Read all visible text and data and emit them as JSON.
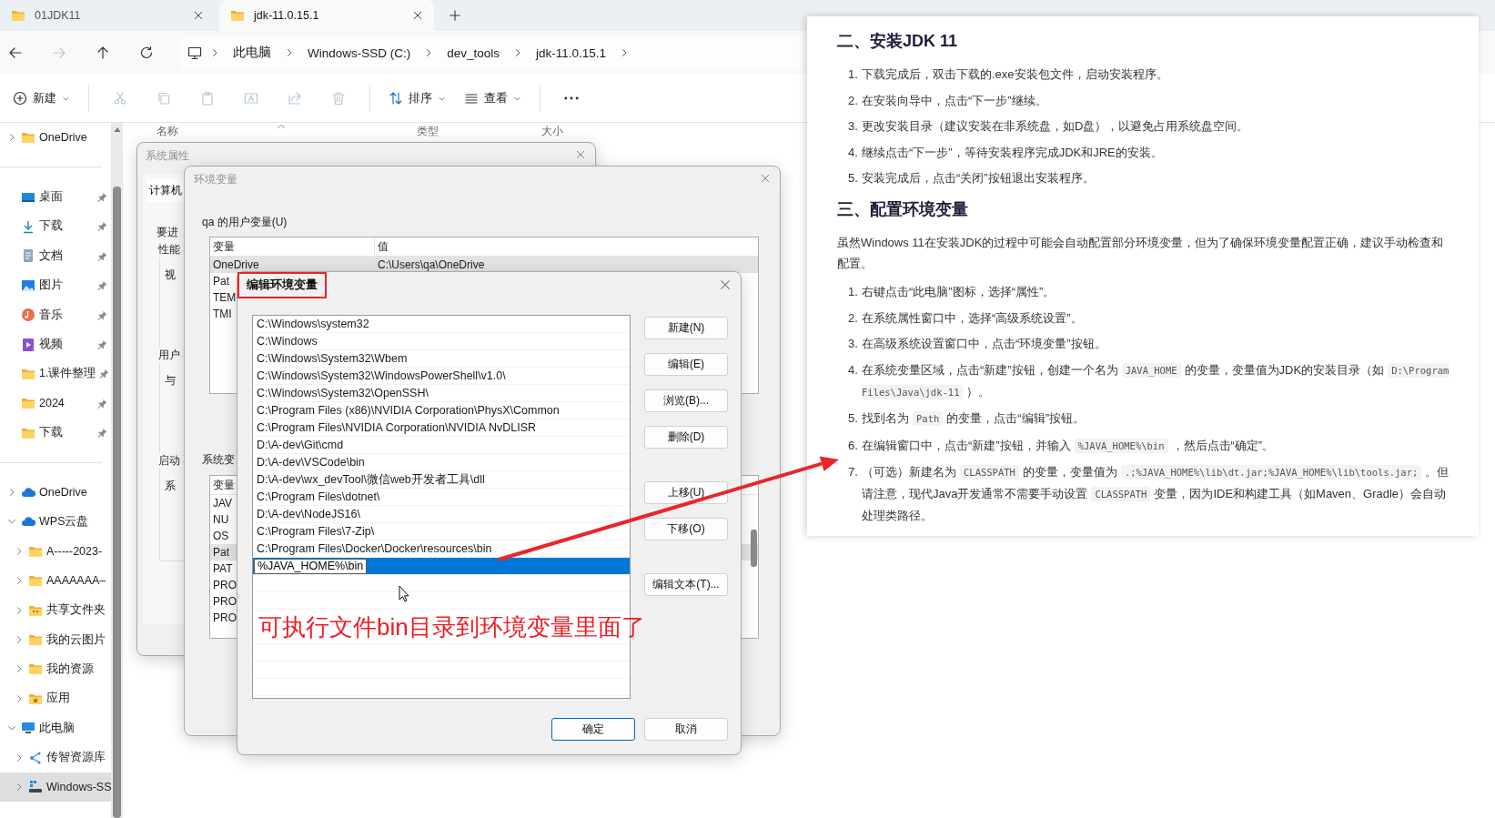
{
  "explorer": {
    "tabs": [
      {
        "label": "01JDK11",
        "selected": false
      },
      {
        "label": "jdk-11.0.15.1",
        "selected": true
      }
    ],
    "nav_buttons": [
      {
        "kind": "back",
        "disabled": false
      },
      {
        "kind": "forward",
        "disabled": true
      },
      {
        "kind": "up",
        "disabled": false
      },
      {
        "kind": "refresh",
        "disabled": false
      }
    ],
    "breadcrumb": [
      "此电脑",
      "Windows-SSD (C:)",
      "dev_tools",
      "jdk-11.0.15.1"
    ],
    "toolbar": [
      [
        {
          "kind": "new",
          "label": "新建",
          "dropdown": true,
          "disabled": false
        }
      ],
      [
        {
          "kind": "cut",
          "disabled": true
        },
        {
          "kind": "copy",
          "disabled": true
        },
        {
          "kind": "paste",
          "disabled": true
        },
        {
          "kind": "rename",
          "disabled": true
        },
        {
          "kind": "share",
          "disabled": true
        },
        {
          "kind": "delete",
          "disabled": true
        }
      ],
      [
        {
          "kind": "sort",
          "label": "排序",
          "dropdown": true,
          "disabled": false
        },
        {
          "kind": "view",
          "label": "查看",
          "dropdown": true,
          "disabled": false
        }
      ],
      [
        {
          "kind": "more",
          "disabled": false
        }
      ]
    ],
    "sidebar": [
      [
        {
          "label": "OneDrive",
          "kind": "folder",
          "expandable": true,
          "expanded": false,
          "pinned": false,
          "selected": false
        }
      ],
      [
        {
          "label": "桌面",
          "kind": "desktop",
          "expandable": false,
          "pinned": true,
          "selected": false
        },
        {
          "label": "下载",
          "kind": "download",
          "expandable": false,
          "pinned": true,
          "selected": false
        },
        {
          "label": "文档",
          "kind": "document",
          "expandable": false,
          "pinned": true,
          "selected": false
        },
        {
          "label": "图片",
          "kind": "picture",
          "expandable": false,
          "pinned": true,
          "selected": false
        },
        {
          "label": "音乐",
          "kind": "music",
          "expandable": false,
          "pinned": true,
          "selected": false
        },
        {
          "label": "视频",
          "kind": "video",
          "expandable": false,
          "pinned": true,
          "selected": false
        },
        {
          "label": "1.课件整理",
          "kind": "folder",
          "expandable": false,
          "pinned": true,
          "selected": false
        },
        {
          "label": "2024",
          "kind": "folder",
          "expandable": false,
          "pinned": true,
          "selected": false
        },
        {
          "label": "下载",
          "kind": "folder",
          "expandable": false,
          "pinned": true,
          "selected": false
        }
      ],
      [
        {
          "label": "OneDrive",
          "kind": "cloud",
          "expandable": true,
          "expanded": false,
          "pinned": false,
          "selected": false
        },
        {
          "label": "WPS云盘",
          "kind": "cloud",
          "expandable": true,
          "expanded": true,
          "pinned": false,
          "selected": false,
          "children": [
            {
              "label": "A-----2023-",
              "kind": "folder",
              "expandable": true,
              "expanded": false,
              "pinned": false,
              "selected": false
            },
            {
              "label": "AAAAAAA–",
              "kind": "folder",
              "expandable": true,
              "expanded": false,
              "pinned": false,
              "selected": false
            },
            {
              "label": "共享文件夹",
              "kind": "shared-folder",
              "expandable": true,
              "expanded": false,
              "pinned": false,
              "selected": false
            },
            {
              "label": "我的云图片",
              "kind": "folder",
              "expandable": true,
              "expanded": false,
              "pinned": false,
              "selected": false
            },
            {
              "label": "我的资源",
              "kind": "folder",
              "expandable": true,
              "expanded": false,
              "pinned": false,
              "selected": false
            },
            {
              "label": "应用",
              "kind": "app-folder",
              "expandable": true,
              "expanded": false,
              "pinned": false,
              "selected": false
            }
          ]
        },
        {
          "label": "此电脑",
          "kind": "computer",
          "expandable": true,
          "expanded": true,
          "pinned": false,
          "selected": false,
          "children": [
            {
              "label": "传智资源库",
              "kind": "network",
              "expandable": true,
              "expanded": false,
              "pinned": false,
              "selected": false
            },
            {
              "label": "Windows-SS",
              "kind": "drive",
              "expandable": true,
              "expanded": false,
              "pinned": false,
              "selected": true
            }
          ]
        }
      ]
    ],
    "columns": [
      "名称",
      "类型",
      "大小"
    ]
  },
  "system_properties": {
    "title": "系统属性",
    "tab": "计算机",
    "intro": "要进",
    "groups": [
      {
        "title": "性能",
        "text": "视"
      },
      {
        "title": "用户",
        "text": "与"
      },
      {
        "title": "启动",
        "text": "系"
      }
    ]
  },
  "environment_variables": {
    "title": "环境变量",
    "user_label": "qa 的用户变量(U)",
    "user_columns": [
      "变量",
      "值"
    ],
    "user_rows": [
      {
        "name": "OneDrive",
        "value": "C:\\Users\\qa\\OneDrive",
        "selected": true
      },
      {
        "name": "Pat",
        "selected": false
      },
      {
        "name": "TEM",
        "selected": false
      },
      {
        "name": "TMI",
        "selected": false
      }
    ],
    "system_label": "系统变",
    "system_columns": [
      "变量"
    ],
    "system_rows": [
      {
        "name": "JAV",
        "selected": false
      },
      {
        "name": "NU",
        "selected": false
      },
      {
        "name": "OS",
        "selected": false
      },
      {
        "name": "Pat",
        "selected": true
      },
      {
        "name": "PAT",
        "selected": false
      },
      {
        "name": "PRO",
        "selected": false
      },
      {
        "name": "PRO",
        "selected": false
      },
      {
        "name": "PRO",
        "selected": false
      }
    ]
  },
  "edit_dialog": {
    "title": "编辑环境变量",
    "title_highlighted": true,
    "entries": [
      {
        "text": "C:\\Windows\\system32",
        "selected": false,
        "editing": false
      },
      {
        "text": "C:\\Windows",
        "selected": false,
        "editing": false
      },
      {
        "text": "C:\\Windows\\System32\\Wbem",
        "selected": false,
        "editing": false
      },
      {
        "text": "C:\\Windows\\System32\\WindowsPowerShell\\v1.0\\",
        "selected": false,
        "editing": false
      },
      {
        "text": "C:\\Windows\\System32\\OpenSSH\\",
        "selected": false,
        "editing": false
      },
      {
        "text": "C:\\Program Files (x86)\\NVIDIA Corporation\\PhysX\\Common",
        "selected": false,
        "editing": false
      },
      {
        "text": "C:\\Program Files\\NVIDIA Corporation\\NVIDIA NvDLISR",
        "selected": false,
        "editing": false
      },
      {
        "text": "D:\\A-dev\\Git\\cmd",
        "selected": false,
        "editing": false
      },
      {
        "text": "D:\\A-dev\\VSCode\\bin",
        "selected": false,
        "editing": false
      },
      {
        "text": "D:\\A-dev\\wx_devTool\\微信web开发者工具\\dll",
        "selected": false,
        "editing": false
      },
      {
        "text": "C:\\Program Files\\dotnet\\",
        "selected": false,
        "editing": false
      },
      {
        "text": "D:\\A-dev\\NodeJS16\\",
        "selected": false,
        "editing": false
      },
      {
        "text": "C:\\Program Files\\7-Zip\\",
        "selected": false,
        "editing": false
      },
      {
        "text": "C:\\Program Files\\Docker\\Docker\\resources\\bin",
        "selected": false,
        "editing": false
      },
      {
        "text": "%JAVA_HOME%\\bin",
        "selected": true,
        "editing": true
      }
    ],
    "side_buttons": [
      [
        "新建(N)",
        "编辑(E)",
        "浏览(B)...",
        "删除(D)"
      ],
      [
        "上移(U)",
        "下移(O)"
      ],
      [
        "编辑文本(T)..."
      ]
    ],
    "ok_button": "确定",
    "cancel_button": "取消"
  },
  "annotation": {
    "note": "可执行文件bin目录到环境变量里面了"
  },
  "document": [
    {
      "kind": "heading",
      "text": "二、安装JDK 11"
    },
    {
      "kind": "list",
      "items": [
        {
          "number": "1.",
          "segments": [
            {
              "kind": "text",
              "text": "下载完成后，双击下载的.exe安装包文件，启动安装程序。"
            }
          ]
        },
        {
          "number": "2.",
          "segments": [
            {
              "kind": "text",
              "text": "在安装向导中，点击“下一步”继续。"
            }
          ]
        },
        {
          "number": "3.",
          "segments": [
            {
              "kind": "text",
              "text": "更改安装目录（建议安装在非系统盘，如D盘），以避免占用系统盘空间。"
            }
          ]
        },
        {
          "number": "4.",
          "segments": [
            {
              "kind": "text",
              "text": "继续点击“下一步”，等待安装程序完成JDK和JRE的安装。"
            }
          ]
        },
        {
          "number": "5.",
          "segments": [
            {
              "kind": "text",
              "text": "安装完成后，点击“关闭”按钮退出安装程序。"
            }
          ]
        }
      ]
    },
    {
      "kind": "heading",
      "text": "三、配置环境变量"
    },
    {
      "kind": "paragraph",
      "text": "虽然Windows 11在安装JDK的过程中可能会自动配置部分环境变量，但为了确保环境变量配置正确，建议手动检查和配置。"
    },
    {
      "kind": "list",
      "items": [
        {
          "number": "1.",
          "segments": [
            {
              "kind": "text",
              "text": "右键点击“此电脑”图标，选择“属性”。"
            }
          ]
        },
        {
          "number": "2.",
          "segments": [
            {
              "kind": "text",
              "text": "在系统属性窗口中，选择“高级系统设置”。"
            }
          ]
        },
        {
          "number": "3.",
          "segments": [
            {
              "kind": "text",
              "text": "在高级系统设置窗口中，点击“环境变量”按钮。"
            }
          ]
        },
        {
          "number": "4.",
          "segments": [
            {
              "kind": "text",
              "text": "在系统变量区域，点击“新建”按钮，创建一个名为"
            },
            {
              "kind": "code",
              "text": "JAVA_HOME"
            },
            {
              "kind": "text",
              "text": "的变量，变量值为JDK的安装目录（如"
            },
            {
              "kind": "code",
              "text": "D:\\Program Files\\Java\\jdk-11"
            },
            {
              "kind": "text",
              "text": "）。"
            }
          ]
        },
        {
          "number": "5.",
          "segments": [
            {
              "kind": "text",
              "text": "找到名为"
            },
            {
              "kind": "code",
              "text": "Path"
            },
            {
              "kind": "text",
              "text": "的变量，点击“编辑”按钮。"
            }
          ]
        },
        {
          "number": "6.",
          "segments": [
            {
              "kind": "text",
              "text": "在编辑窗口中，点击“新建”按钮，并输入"
            },
            {
              "kind": "code",
              "text": "%JAVA_HOME%\\bin"
            },
            {
              "kind": "text",
              "text": "，然后点击“确定”。"
            }
          ]
        },
        {
          "number": "7.",
          "segments": [
            {
              "kind": "text",
              "text": "（可选）新建名为"
            },
            {
              "kind": "code",
              "text": "CLASSPATH"
            },
            {
              "kind": "text",
              "text": "的变量，变量值为"
            },
            {
              "kind": "code",
              "text": ".;%JAVA_HOME%\\lib\\dt.jar;%JAVA_HOME%\\lib\\tools.jar;"
            },
            {
              "kind": "text",
              "text": "。但请注意，现代Java开发通常不需要手动设置"
            },
            {
              "kind": "code",
              "text": "CLASSPATH"
            },
            {
              "kind": "text",
              "text": "变量，因为IDE和构建工具（如Maven、Gradle）会自动处理类路径。"
            }
          ]
        }
      ]
    }
  ]
}
